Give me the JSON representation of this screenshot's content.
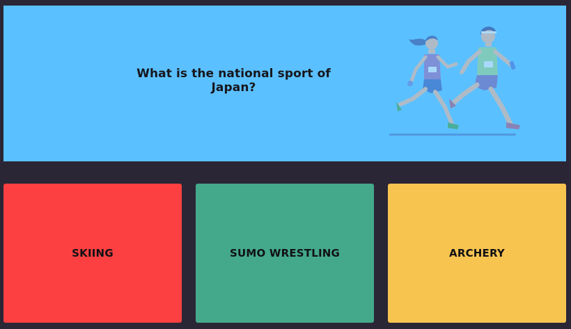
{
  "question": {
    "text": "What is the national sport of Japan?",
    "background_color": "#5bc0ff",
    "illustration": "runners-illustration"
  },
  "answers": [
    {
      "label": "SKIING",
      "color": "#fc4042"
    },
    {
      "label": "SUMO WRESTLING",
      "color": "#44a98b"
    },
    {
      "label": "ARCHERY",
      "color": "#f8c450"
    }
  ],
  "theme": {
    "page_background": "#2a2636"
  }
}
